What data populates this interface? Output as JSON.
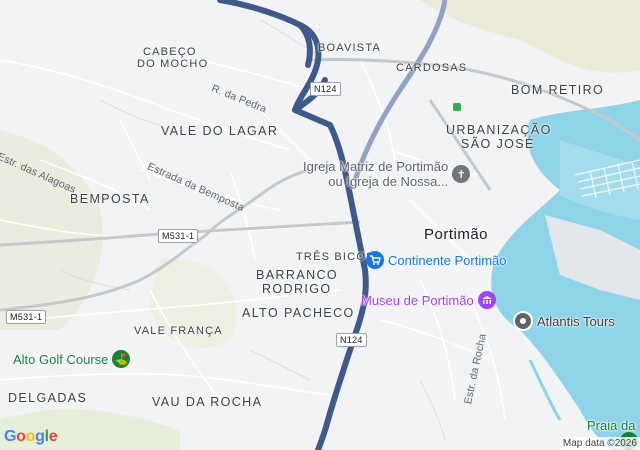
{
  "map": {
    "city": "Portimão",
    "areas": {
      "boavista": "BOAVISTA",
      "cabeco_do_mocho_1": "CABEÇO",
      "cabeco_do_mocho_2": "DO MOCHO",
      "cardosas": "CARDOSAS",
      "bom_retiro": "BOM RETIRO",
      "vale_do_lagar": "VALE DO LAGAR",
      "urbanizacao_1": "URBANIZAÇÃO",
      "urbanizacao_2": "SÃO JOSÉ",
      "bemposta": "BEMPOSTA",
      "tres_bicos": "TRÊS BICOS",
      "barranco_1": "BARRANCO",
      "barranco_2": "RODRIGO",
      "alto_pacheco": "ALTO PACHECO",
      "vale_franca": "VALE FRANÇA",
      "delgadas": "DELGADAS",
      "vau_da_rocha": "VAU DA ROCHA"
    },
    "roads": {
      "r_da_pedra": "R. da Pedra",
      "estrada_bemposta": "Estrada da Bemposta",
      "estr_alagoas": "Estr. das Alagoas",
      "estr_da_rocha": "Estr. da Rocha"
    },
    "shields": {
      "n124_top": "N124",
      "n124_bottom": "N124",
      "m531_1_a": "M531-1",
      "m531_1_b": "M531-1"
    },
    "pois": {
      "igreja_1": "Igreja Matriz de Portimão",
      "igreja_2": "ou Igreja de Nossa...",
      "continente": "Continente Portimão",
      "museu": "Museu de Portimão",
      "atlantis": "Atlantis Tours",
      "alto_golf": "Alto Golf Course",
      "praia": "Praia da"
    },
    "colors": {
      "route": "#3f5a8a",
      "water": "#8fd3e8",
      "shopping": "#1a73e8",
      "museum": "#a142f4",
      "golf": "#188038",
      "tour": "#5f6368"
    }
  },
  "branding": {
    "logo": "Google",
    "attribution": "Map data ©2026"
  }
}
